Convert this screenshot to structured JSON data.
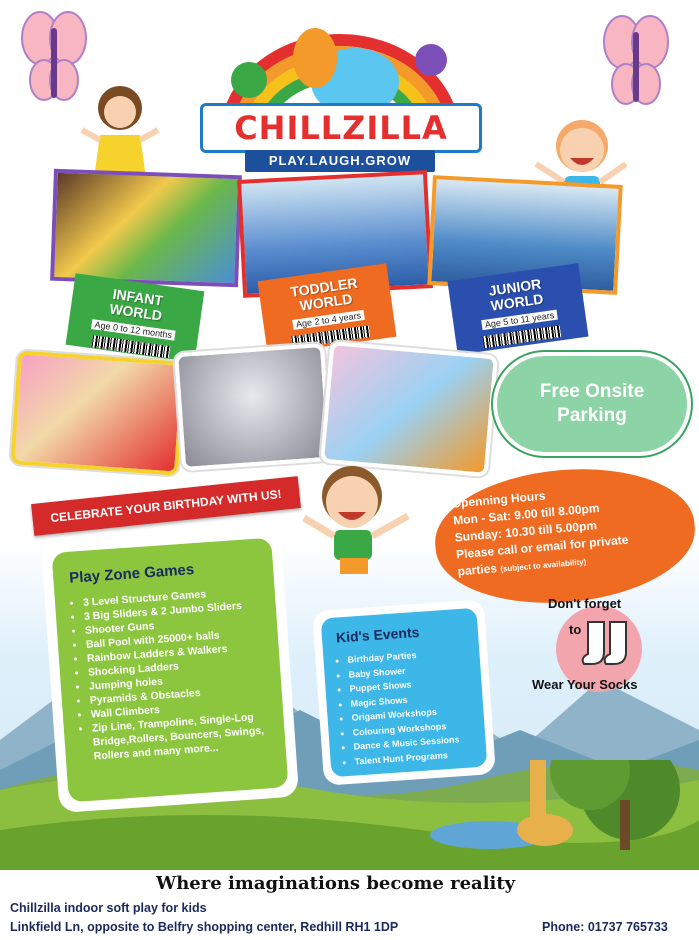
{
  "brand": {
    "name": "CHILLZILLA",
    "tagline": "PLAY.LAUGH.GROW",
    "colors": {
      "red": "#e3302f",
      "blue": "#1f7ac9",
      "green": "#3aa845",
      "yellow": "#f7c11c",
      "orange": "#f06b22",
      "navy": "#1c4f9c"
    }
  },
  "worlds": [
    {
      "title_line1": "INFANT",
      "title_line2": "WORLD",
      "age": "Age 0 to 12 months",
      "color": "#3aa845"
    },
    {
      "title_line1": "TODDLER",
      "title_line2": "WORLD",
      "age": "Age 2 to 4 years",
      "color": "#f06b22"
    },
    {
      "title_line1": "JUNIOR",
      "title_line2": "WORLD",
      "age": "Age 5 to 11 years",
      "color": "#2b4fae"
    }
  ],
  "parking": {
    "line1": "Free Onsite",
    "line2": "Parking"
  },
  "birthday_banner": "CELEBRATE YOUR BIRTHDAY WITH US!",
  "hours": {
    "heading": "Openning Hours",
    "weekday": "Mon - Sat: 9.00 till 8.00pm",
    "sunday": "Sunday: 10.30 till 5.00pm",
    "private1": "Please call or email for private",
    "private2": "parties",
    "private_note": "(subject to availability)"
  },
  "play_zone": {
    "title": "Play Zone Games",
    "items": [
      "3 Level Structure Games",
      "3 Big Sliders & 2 Jumbo Sliders",
      "Shooter Guns",
      "Ball Pool with 25000+ balls",
      "Rainbow Ladders & Walkers",
      "Shocking Ladders",
      "Jumping holes",
      "Pyramids & Obstacles",
      "Wall Climbers",
      "Zip Line, Trampoline, Single-Log Bridge,Rollers, Bouncers, Swings, Rollers and many more..."
    ]
  },
  "kids_events": {
    "title": "Kid's Events",
    "items": [
      "Birthday Parties",
      "Baby Shower",
      "Puppet Shows",
      "Magic Shows",
      "Origami Workshops",
      "Colouring Workshops",
      "Dance & Music Sessions",
      "Talent Hunt Programs"
    ]
  },
  "socks": {
    "line1": "Don't forget",
    "line2": "to",
    "line3": "Wear Your Socks"
  },
  "footer": {
    "tagline": "Where imaginations become reality",
    "name": "Chillzilla indoor soft play for kids",
    "address": "Linkfield Ln, opposite to Belfry shopping center, Redhill RH1 1DP",
    "phone": "Phone: 01737 765733"
  }
}
